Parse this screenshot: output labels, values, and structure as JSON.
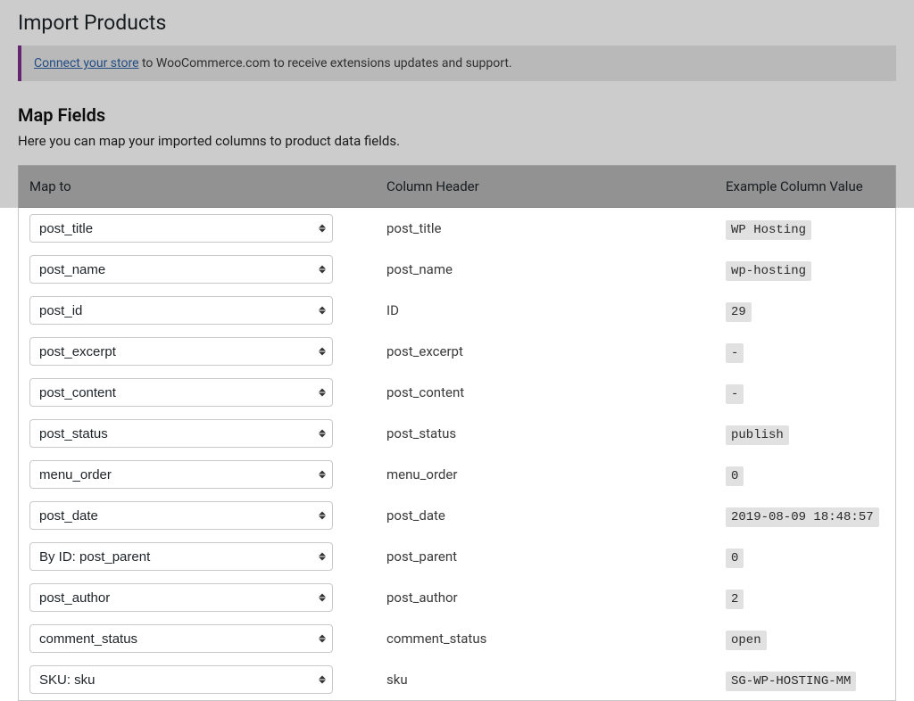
{
  "page": {
    "title": "Import Products"
  },
  "notice": {
    "link_text": "Connect your store",
    "rest": " to WooCommerce.com to receive extensions updates and support."
  },
  "section": {
    "title": "Map Fields",
    "description": "Here you can map your imported columns to product data fields."
  },
  "table": {
    "headers": {
      "map_to": "Map to",
      "column_header": "Column Header",
      "example": "Example Column Value"
    },
    "rows": [
      {
        "select": "post_title",
        "header": "post_title",
        "example": "WP Hosting"
      },
      {
        "select": "post_name",
        "header": "post_name",
        "example": "wp-hosting"
      },
      {
        "select": "post_id",
        "header": "ID",
        "example": "29"
      },
      {
        "select": "post_excerpt",
        "header": "post_excerpt",
        "example": "-"
      },
      {
        "select": "post_content",
        "header": "post_content",
        "example": "-"
      },
      {
        "select": "post_status",
        "header": "post_status",
        "example": "publish"
      },
      {
        "select": "menu_order",
        "header": "menu_order",
        "example": "0"
      },
      {
        "select": "post_date",
        "header": "post_date",
        "example": "2019-08-09 18:48:57"
      },
      {
        "select": "By ID: post_parent",
        "header": "post_parent",
        "example": "0"
      },
      {
        "select": "post_author",
        "header": "post_author",
        "example": "2"
      },
      {
        "select": "comment_status",
        "header": "comment_status",
        "example": "open"
      },
      {
        "select": "SKU: sku",
        "header": "sku",
        "example": "SG-WP-HOSTING-MM"
      }
    ]
  }
}
